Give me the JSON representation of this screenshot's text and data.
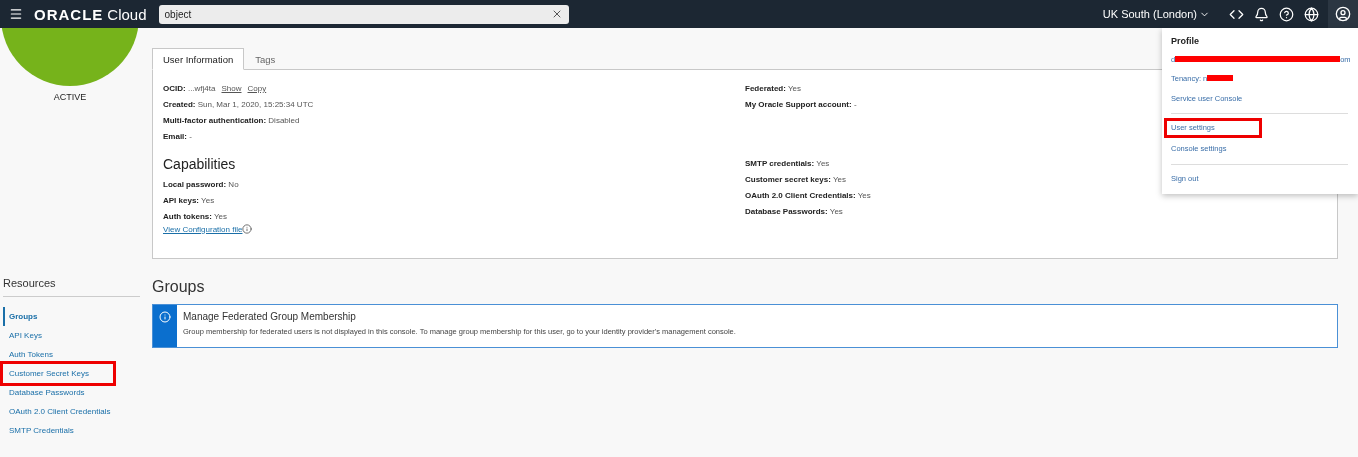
{
  "topbar": {
    "brand": "ORACLE",
    "brand_suffix": "Cloud",
    "search": {
      "value": "object"
    },
    "region": "UK South (London)"
  },
  "user": {
    "status": "ACTIVE"
  },
  "tabs": [
    {
      "label": "User Information",
      "selected": true
    },
    {
      "label": "Tags",
      "selected": false
    }
  ],
  "info_left": [
    {
      "label": "OCID:",
      "value": "...wfj4ta",
      "links": [
        "Show",
        "Copy"
      ]
    },
    {
      "label": "Created:",
      "value": "Sun, Mar 1, 2020, 15:25:34 UTC"
    },
    {
      "label": "Multi-factor authentication:",
      "value": "Disabled"
    },
    {
      "label": "Email:",
      "value": "-"
    }
  ],
  "info_right": [
    {
      "label": "Federated:",
      "value": "Yes"
    },
    {
      "label": "My Oracle Support account:",
      "value": "-"
    }
  ],
  "capabilities": {
    "title": "Capabilities",
    "left": [
      {
        "label": "Local password:",
        "value": "No"
      },
      {
        "label": "API keys:",
        "value": "Yes"
      },
      {
        "label": "Auth tokens:",
        "value": "Yes"
      }
    ],
    "right": [
      {
        "label": "SMTP credentials:",
        "value": "Yes"
      },
      {
        "label": "Customer secret keys:",
        "value": "Yes"
      },
      {
        "label": "OAuth 2.0 Client Credentials:",
        "value": "Yes"
      },
      {
        "label": "Database Passwords:",
        "value": "Yes"
      }
    ],
    "config_link": "View Configuration file"
  },
  "resources": {
    "title": "Resources",
    "items": [
      {
        "label": "Groups",
        "selected": true,
        "highlighted": false
      },
      {
        "label": "API Keys",
        "selected": false,
        "highlighted": false
      },
      {
        "label": "Auth Tokens",
        "selected": false,
        "highlighted": false
      },
      {
        "label": "Customer Secret Keys",
        "selected": false,
        "highlighted": true
      },
      {
        "label": "Database Passwords",
        "selected": false,
        "highlighted": false
      },
      {
        "label": "OAuth 2.0 Client Credentials",
        "selected": false,
        "highlighted": false
      },
      {
        "label": "SMTP Credentials",
        "selected": false,
        "highlighted": false
      }
    ]
  },
  "groups": {
    "title": "Groups",
    "notice": {
      "title": "Manage Federated Group Membership",
      "text": "Group membership for federated users is not displayed in this console. To manage group membership for this user, go to your identity provider's management console."
    }
  },
  "profile_menu": {
    "title": "Profile",
    "email_start": "d",
    "email_end": "om",
    "tenancy": "Tenancy: n",
    "sections": [
      [
        {
          "label": "Service user Console",
          "highlighted": false
        }
      ],
      [
        {
          "label": "User settings",
          "highlighted": true
        },
        {
          "label": "Console settings",
          "highlighted": false
        }
      ],
      [
        {
          "label": "Sign out",
          "highlighted": false
        }
      ]
    ]
  }
}
